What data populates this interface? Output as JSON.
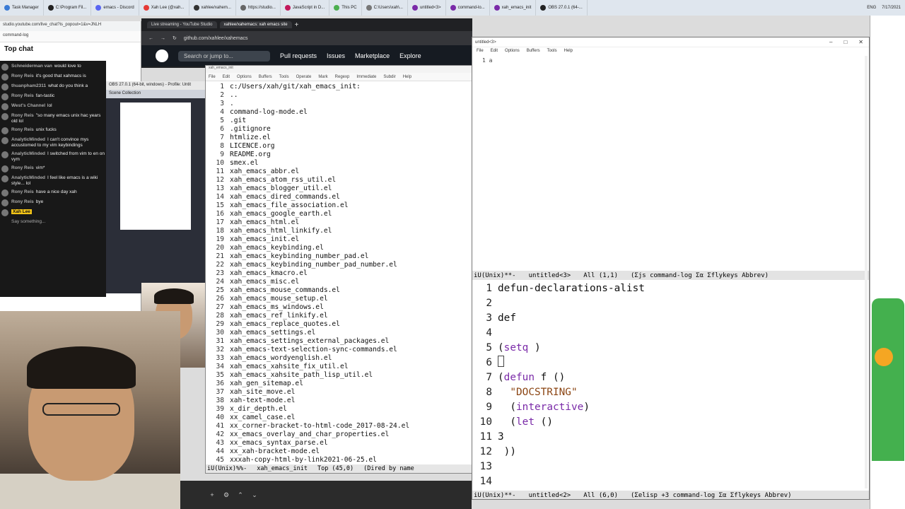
{
  "top_tabs": [
    {
      "label": "Task Manager",
      "color": "#3a7bd5"
    },
    {
      "label": "C:\\Program Fil...",
      "color": "#222"
    },
    {
      "label": "emacs - Discord",
      "color": "#5865f2"
    },
    {
      "label": "Xah Lee (@xah...",
      "color": "#e53935"
    },
    {
      "label": "xahlee/xahem...",
      "color": "#333"
    },
    {
      "label": "https://studio...",
      "color": "#666"
    },
    {
      "label": "JavaScript in D...",
      "color": "#c2185b"
    },
    {
      "label": "This PC",
      "color": "#4caf50"
    },
    {
      "label": "C:\\Users\\xah\\...",
      "color": "#777"
    },
    {
      "label": "untitled<3>",
      "color": "#7a2aa8"
    },
    {
      "label": "command-lo...",
      "color": "#7a2aa8"
    },
    {
      "label": "xah_emacs_init",
      "color": "#7a2aa8"
    },
    {
      "label": "OBS 27.0.1 (64-...",
      "color": "#222"
    }
  ],
  "tray": {
    "lang": "ENG",
    "time": "7/17/2021"
  },
  "youtube": {
    "url": "studio.youtube.com/live_chat?is_popout=1&v=JNLH",
    "top_title": "command-log",
    "header": "Top chat",
    "messages": [
      {
        "name": "Schneiderman van",
        "text": "would love to"
      },
      {
        "name": "Rony Reis",
        "text": "it's good that xahmacs is"
      },
      {
        "name": "thuanpham2311",
        "text": "what do you think a"
      },
      {
        "name": "Rony Reis",
        "text": "fan-tastic"
      },
      {
        "name": "West's Channel",
        "text": "lol"
      },
      {
        "name": "Rony Reis",
        "text": "\"so many emacs unix hac years old lol"
      },
      {
        "name": "Rony Reis",
        "text": "unix fucks"
      },
      {
        "name": "AnalyticMinded",
        "text": "I can't convince mys accustomed to my vim keybindings"
      },
      {
        "name": "AnalyticMinded",
        "text": "I switched from vim to en on vym"
      },
      {
        "name": "Rony Reis",
        "text": "vim*"
      },
      {
        "name": "AnalyticMinded",
        "text": "I feel like emacs is a wiki style... lol"
      },
      {
        "name": "Rony Reis",
        "text": "have a nice day xah"
      },
      {
        "name": "Rony Reis",
        "text": "bye"
      },
      {
        "name": "Xah Lee",
        "text": ""
      }
    ],
    "say_something": "Say something..."
  },
  "obs": {
    "title": "OBS 27.0.1 (64-bit, windows) - Profile: Untit",
    "scene": "Scene Collection"
  },
  "github": {
    "tabs": [
      "Live streaming - YouTube Studio",
      "xahlee/xahemacs: xah emacs site"
    ],
    "url": "github.com/xahlee/xahemacs",
    "search": "Search or jump to...",
    "nav": [
      "Pull requests",
      "Issues",
      "Marketplace",
      "Explore"
    ]
  },
  "emacs_left": {
    "title": "xah_emacs_init",
    "menu": [
      "File",
      "Edit",
      "Options",
      "Buffers",
      "Tools",
      "Operate",
      "Mark",
      "Regexp",
      "Immediate",
      "Subdir",
      "Help"
    ],
    "lines": [
      {
        "n": "1",
        "t": "c:/Users/xah/git/xah_emacs_init:"
      },
      {
        "n": "2",
        "t": ".."
      },
      {
        "n": "3",
        "t": "."
      },
      {
        "n": "4",
        "t": "command-log-mode.el"
      },
      {
        "n": "5",
        "t": ".git"
      },
      {
        "n": "6",
        "t": ".gitignore"
      },
      {
        "n": "7",
        "t": "htmlize.el"
      },
      {
        "n": "8",
        "t": "LICENCE.org"
      },
      {
        "n": "9",
        "t": "README.org"
      },
      {
        "n": "10",
        "t": "smex.el"
      },
      {
        "n": "11",
        "t": "xah_emacs_abbr.el"
      },
      {
        "n": "12",
        "t": "xah_emacs_atom_rss_util.el"
      },
      {
        "n": "13",
        "t": "xah_emacs_blogger_util.el"
      },
      {
        "n": "14",
        "t": "xah_emacs_dired_commands.el"
      },
      {
        "n": "15",
        "t": "xah_emacs_file_association.el"
      },
      {
        "n": "16",
        "t": "xah_emacs_google_earth.el"
      },
      {
        "n": "17",
        "t": "xah_emacs_html.el"
      },
      {
        "n": "18",
        "t": "xah_emacs_html_linkify.el"
      },
      {
        "n": "19",
        "t": "xah_emacs_init.el"
      },
      {
        "n": "20",
        "t": "xah_emacs_keybinding.el"
      },
      {
        "n": "21",
        "t": "xah_emacs_keybinding_number_pad.el"
      },
      {
        "n": "22",
        "t": "xah_emacs_keybinding_number_pad_number.el"
      },
      {
        "n": "23",
        "t": "xah_emacs_kmacro.el"
      },
      {
        "n": "24",
        "t": "xah_emacs_misc.el"
      },
      {
        "n": "25",
        "t": "xah_emacs_mouse_commands.el"
      },
      {
        "n": "26",
        "t": "xah_emacs_mouse_setup.el"
      },
      {
        "n": "27",
        "t": "xah_emacs_ms_windows.el"
      },
      {
        "n": "28",
        "t": "xah_emacs_ref_linkify.el"
      },
      {
        "n": "29",
        "t": "xah_emacs_replace_quotes.el"
      },
      {
        "n": "30",
        "t": "xah_emacs_settings.el"
      },
      {
        "n": "31",
        "t": "xah_emacs_settings_external_packages.el"
      },
      {
        "n": "32",
        "t": "xah_emacs-text-selection-sync-commands.el"
      },
      {
        "n": "33",
        "t": "xah_emacs_wordyenglish.el"
      },
      {
        "n": "34",
        "t": "xah_emacs_xahsite_fix_util.el"
      },
      {
        "n": "35",
        "t": "xah_emacs_xahsite_path_lisp_util.el"
      },
      {
        "n": "36",
        "t": "xah_gen_sitemap.el"
      },
      {
        "n": "37",
        "t": "xah_site_move.el"
      },
      {
        "n": "38",
        "t": "xah-text-mode.el"
      },
      {
        "n": "39",
        "t": "x_dir_depth.el"
      },
      {
        "n": "40",
        "t": "xx_camel_case.el"
      },
      {
        "n": "41",
        "t": "xx_corner-bracket-to-html-code_2017-08-24.el"
      },
      {
        "n": "42",
        "t": "xx_emacs_overlay_and_char_properties.el"
      },
      {
        "n": "43",
        "t": "xx_emacs_syntax_parse.el"
      },
      {
        "n": "44",
        "t": "xx_xah-bracket-mode.el"
      },
      {
        "n": "45",
        "t": "xxxah-copy-html-by-link2021-06-25.el"
      }
    ],
    "modeline": {
      "state": "iU(Unix)%%-",
      "buffer": "xah_emacs_init",
      "pos": "Top (45,0)",
      "mode": "(Dired by name"
    }
  },
  "emacs_right": {
    "title": "untitled<3>",
    "menu": [
      "File",
      "Edit",
      "Options",
      "Buffers",
      "Tools",
      "Help"
    ],
    "top_buffer_text": "1 a",
    "modeline_top": {
      "state": "iU(Unix)**-",
      "buffer": "untitled<3>",
      "pos": "All (1,1)",
      "mode": "(Σjs command-log Σα Σflykeys Abbrev)"
    },
    "lines": [
      {
        "n": "1",
        "t": "defun-declarations-alist"
      },
      {
        "n": "2",
        "t": ""
      },
      {
        "n": "3",
        "t": "def"
      },
      {
        "n": "4",
        "t": ""
      },
      {
        "n": "5",
        "t": "(setq )"
      },
      {
        "n": "6",
        "t": ""
      },
      {
        "n": "7",
        "t": "(defun f ()"
      },
      {
        "n": "8",
        "t": "  \"DOCSTRING\""
      },
      {
        "n": "9",
        "t": "  (interactive)"
      },
      {
        "n": "10",
        "t": "  (let ()"
      },
      {
        "n": "11",
        "t": "3"
      },
      {
        "n": "12",
        "t": " ))"
      },
      {
        "n": "13",
        "t": ""
      },
      {
        "n": "14",
        "t": ""
      }
    ],
    "modeline_bottom": {
      "state": "iU(Unix)**-",
      "buffer": "untitled<2>",
      "pos": "All (6,0)",
      "mode": "(Σelisp +3 command-log Σα Σflykeys Abbrev)"
    }
  },
  "colors": {
    "emacs_bg": "#ffffff",
    "modeline": "#e3e3e3",
    "keyword": "#7a2aa8",
    "string": "#8b4513"
  }
}
